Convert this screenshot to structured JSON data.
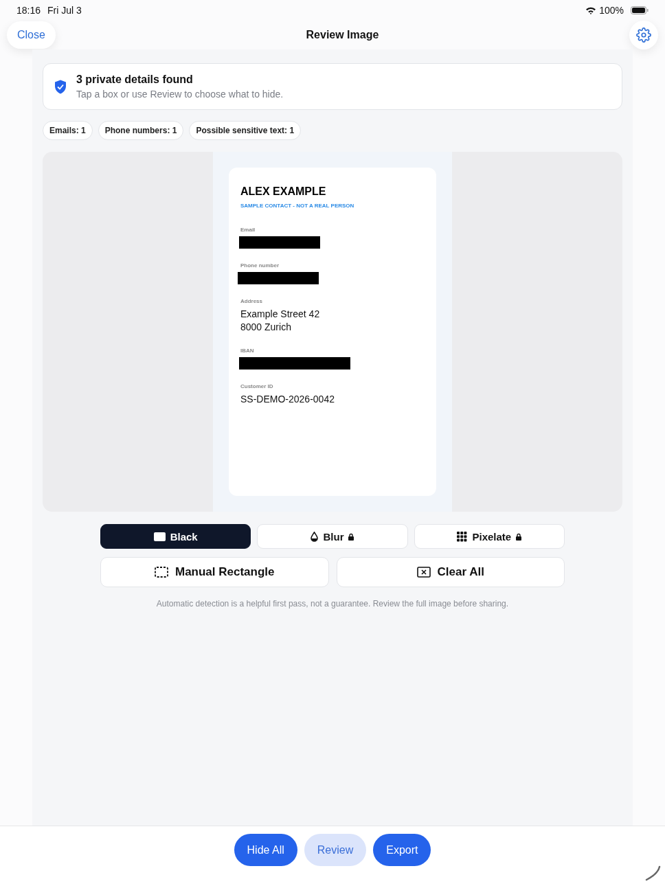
{
  "status_bar": {
    "time": "18:16",
    "date": "Fri Jul 3",
    "battery": "100%"
  },
  "nav": {
    "close": "Close",
    "title": "Review Image"
  },
  "summary": {
    "title": "3 private details found",
    "subtitle": "Tap a box or use Review to choose what to hide."
  },
  "chips": [
    "Emails: 1",
    "Phone numbers: 1",
    "Possible sensitive text: 1"
  ],
  "document": {
    "name": "ALEX EXAMPLE",
    "tagline": "SAMPLE CONTACT - NOT A REAL PERSON",
    "fields": [
      {
        "label": "Email",
        "kind": "redacted"
      },
      {
        "label": "Phone number",
        "kind": "redacted"
      },
      {
        "label": "Address",
        "kind": "text",
        "lines": [
          "Example Street 42",
          "8000 Zurich"
        ]
      },
      {
        "label": "IBAN",
        "kind": "redacted"
      },
      {
        "label": "Customer ID",
        "kind": "text",
        "lines": [
          "SS-DEMO-2026-0042"
        ]
      }
    ]
  },
  "styles": [
    {
      "label": "Black",
      "kind": "black",
      "selected": true,
      "locked": false
    },
    {
      "label": "Blur",
      "kind": "blur",
      "selected": false,
      "locked": true
    },
    {
      "label": "Pixelate",
      "kind": "pixelate",
      "selected": false,
      "locked": true
    }
  ],
  "actions": [
    {
      "label": "Manual Rectangle",
      "kind": "rectangle"
    },
    {
      "label": "Clear All",
      "kind": "clear"
    }
  ],
  "disclaimer": "Automatic detection is a helpful first pass, not a guarantee. Review the full image before sharing.",
  "bottom_buttons": [
    {
      "label": "Hide All",
      "kind": "primary"
    },
    {
      "label": "Review",
      "kind": "secondary"
    },
    {
      "label": "Export",
      "kind": "primary"
    }
  ]
}
